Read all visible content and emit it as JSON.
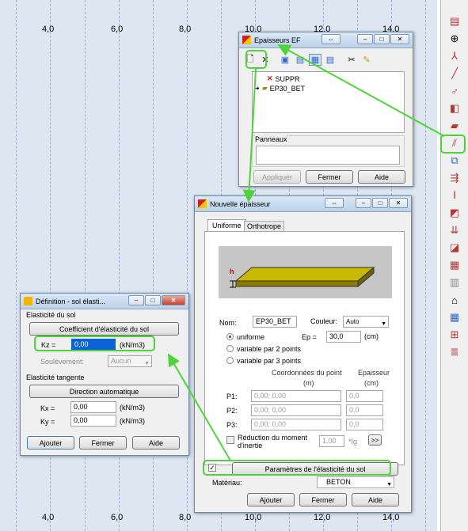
{
  "canvas": {
    "ticks_top": [
      "4,0",
      "6,0",
      "8,0",
      "10,0",
      "12,0",
      "14,0"
    ],
    "ticks_bottom": [
      "4,0",
      "6,0",
      "8,0",
      "10,0",
      "12,0",
      "14,0"
    ]
  },
  "epaisseurs": {
    "title": "Epaisseurs EF",
    "list": [
      "SUPPR",
      "EP30_BET"
    ],
    "panneaux_label": "Panneaux",
    "buttons": {
      "appliquer": "Appliquer",
      "fermer": "Fermer",
      "aide": "Aide"
    }
  },
  "nouvelle": {
    "title": "Nouvelle épaisseur",
    "tabs": [
      "Uniforme",
      "Orthotrope"
    ],
    "preview_h": "h",
    "nom_label": "Nom:",
    "nom_value": "EP30_BET",
    "couleur_label": "Couleur:",
    "couleur_value": "Auto",
    "radio_uniforme": "uniforme",
    "radio_2pts": "variable par 2 points",
    "radio_3pts": "variable par 3 points",
    "ep_label": "Ep =",
    "ep_value": "30,0",
    "ep_unit": "(cm)",
    "coord_header": "Coordonnées du point",
    "coord_unit": "(m)",
    "ep_header": "Epaisseur",
    "ep_header_unit": "(cm)",
    "points": [
      {
        "label": "P1:",
        "coord": "0,00; 0,00",
        "ep": "0,0"
      },
      {
        "label": "P2:",
        "coord": "0,00; 0,00",
        "ep": "0,0"
      },
      {
        "label": "P3:",
        "coord": "0,00; 0,00",
        "ep": "0,0"
      }
    ],
    "reduction_label": "Réduction du moment d'inertie",
    "reduction_value": "1,00",
    "reduction_unit": "*Ig",
    "more_btn": ">>",
    "elasticite_btn": "Paramètres de l'élasticité du sol",
    "materiau_label": "Matériau:",
    "materiau_value": "BETON",
    "buttons": {
      "ajouter": "Ajouter",
      "fermer": "Fermer",
      "aide": "Aide"
    }
  },
  "definition": {
    "title": "Définition - sol élasti...",
    "elasticite_sol": "Elasticité du sol",
    "coeff_btn": "Coefficient d'élasticité du sol",
    "kz_label": "Kz =",
    "kz_value": "0,00",
    "kz_unit": "(kN/m3)",
    "soulevement_label": "Soulèvement:",
    "soulevement_value": "Aucun",
    "tangente_label": "Elasticité tangente",
    "direction_btn": "Direction automatique",
    "kx_label": "Kx =",
    "kx_value": "0,00",
    "kx_unit": "(kN/m3)",
    "ky_label": "Ky =",
    "ky_value": "0,00",
    "ky_unit": "(kN/m3)",
    "buttons": {
      "ajouter": "Ajouter",
      "fermer": "Fermer",
      "aide": "Aide"
    }
  },
  "colors": {
    "highlight": "#4ed43a",
    "slab": "#c9b800",
    "selection": "#0a64d6"
  }
}
